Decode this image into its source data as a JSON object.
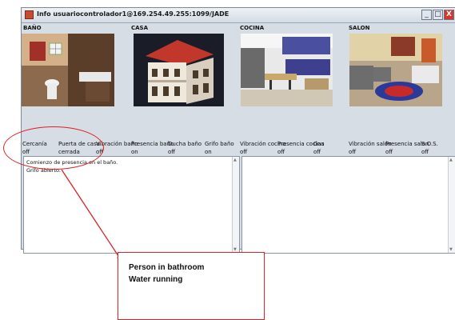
{
  "window": {
    "title": "Info usuariocontrolador1@169.254.49.255:1099/JADE",
    "minimize_symbol": "_",
    "maximize_symbol": "□",
    "close_symbol": "X"
  },
  "rooms": [
    {
      "label": "BAÑO"
    },
    {
      "label": "CASA"
    },
    {
      "label": "COCINA"
    },
    {
      "label": "SALON"
    }
  ],
  "sensors": [
    {
      "name": "Cercanía",
      "value": "off"
    },
    {
      "name": "Puerta de casa",
      "value": "cerrada"
    },
    {
      "name": "Vibración baño",
      "value": "off"
    },
    {
      "name": "Presencia baño",
      "value": "on"
    },
    {
      "name": "Ducha baño",
      "value": "off"
    },
    {
      "name": "Grifo baño",
      "value": "on"
    },
    {
      "name": "Vibración cocina",
      "value": "off"
    },
    {
      "name": "Presencia cocina",
      "value": "off"
    },
    {
      "name": "Gas",
      "value": "off"
    },
    {
      "name": "Vibración salón",
      "value": "off"
    },
    {
      "name": "Presencia salon",
      "value": "off"
    },
    {
      "name": "S.O.S.",
      "value": "off"
    }
  ],
  "log": {
    "line1": "Comienzo de presencia en el baño.",
    "line2": "Grifo abierto."
  },
  "annotation": {
    "line1": "Person in bathroom",
    "line2": "Water running"
  },
  "colors": {
    "annotation": "#dd2222",
    "window_frame": "#d6dde5"
  }
}
